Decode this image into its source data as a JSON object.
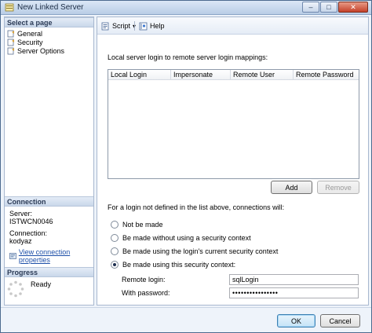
{
  "window": {
    "title": "New Linked Server",
    "minimize": "–",
    "maximize": "□",
    "close": "✕"
  },
  "left": {
    "select_header": "Select a page",
    "pages": [
      "General",
      "Security",
      "Server Options"
    ],
    "connection_header": "Connection",
    "server_label": "Server:",
    "server_value": "ISTWCN0046",
    "connection_label": "Connection:",
    "connection_value": "kodyaz",
    "view_link": "View connection properties",
    "progress_header": "Progress",
    "progress_status": "Ready"
  },
  "toolbar": {
    "script": "Script",
    "script_arrow": "▾",
    "help": "Help"
  },
  "main": {
    "mappings_label": "Local server login to remote server login mappings:",
    "columns": [
      "Local Login",
      "Impersonate",
      "Remote User",
      "Remote Password"
    ],
    "add_label": "Add",
    "remove_label": "Remove",
    "undefined_label": "For a login not defined in the list above, connections will:",
    "options": [
      "Not be made",
      "Be made without using a security context",
      "Be made using the login's current security context",
      "Be made using this security context:"
    ],
    "selected_option": 3,
    "remote_login_label": "Remote login:",
    "remote_login_value": "sqlLogin",
    "password_label": "With password:",
    "password_value": "••••••••••••••••"
  },
  "footer": {
    "ok": "OK",
    "cancel": "Cancel"
  },
  "colors": {
    "accent": "#1d4fa8",
    "chrome": "#eef3fa",
    "border": "#a8b8cf"
  }
}
